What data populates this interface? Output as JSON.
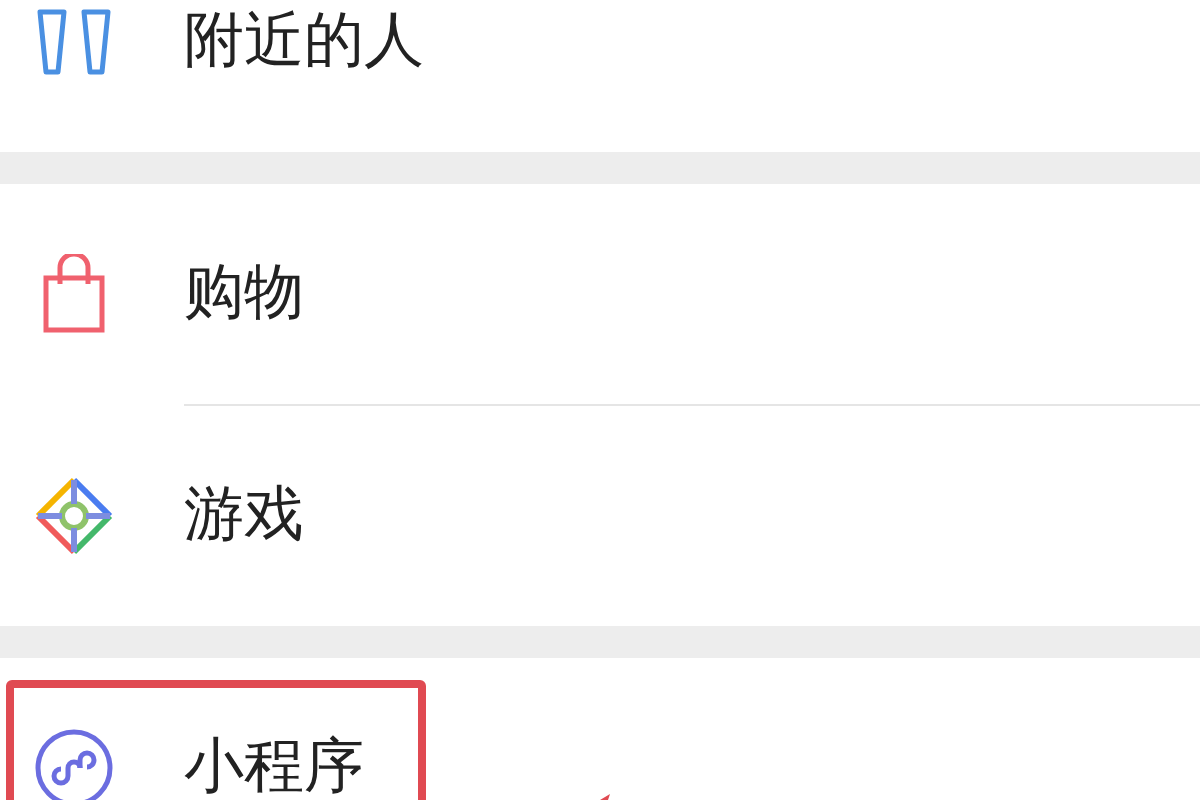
{
  "sections": [
    {
      "items": [
        {
          "kind": "nearby",
          "label": "附近的人",
          "highlighted": false
        }
      ]
    },
    {
      "items": [
        {
          "kind": "shopping",
          "label": "购物",
          "highlighted": false
        },
        {
          "kind": "games",
          "label": "游戏",
          "highlighted": false
        }
      ]
    },
    {
      "items": [
        {
          "kind": "miniprogram",
          "label": "小程序",
          "highlighted": true
        }
      ]
    }
  ]
}
